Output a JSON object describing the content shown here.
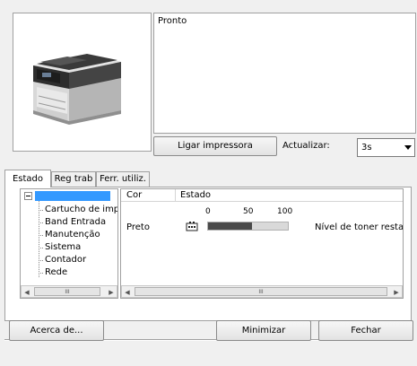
{
  "status": {
    "message": "Pronto"
  },
  "controls": {
    "power_button": "Ligar impressora",
    "refresh_label": "Actualizar:",
    "refresh_value": "3s"
  },
  "tabs": [
    {
      "label": "Estado",
      "active": true
    },
    {
      "label": "Reg trab",
      "active": false
    },
    {
      "label": "Ferr. utiliz.",
      "active": false
    }
  ],
  "tree": {
    "items": [
      "Cartucho de imp",
      "Band Entrada",
      "Manutenção",
      "Sistema",
      "Contador",
      "Rede"
    ],
    "scroll_thumb": "III"
  },
  "table": {
    "headers": [
      "Cor",
      "Estado"
    ],
    "scale_labels": [
      "0",
      "50",
      "100"
    ],
    "rows": [
      {
        "color": "Preto",
        "level_percent": 55,
        "status": "Nível de toner resta.."
      }
    ],
    "scroll_thumb": "III"
  },
  "buttons": {
    "about": "Acerca de...",
    "minimize": "Minimizar",
    "close": "Fechar"
  },
  "colors": {
    "toner_fill": "#4a4a4a",
    "selection": "#3399ff"
  },
  "icons": {
    "toner": "toner-cartridge-icon",
    "collapse": "tree-collapse-icon"
  }
}
